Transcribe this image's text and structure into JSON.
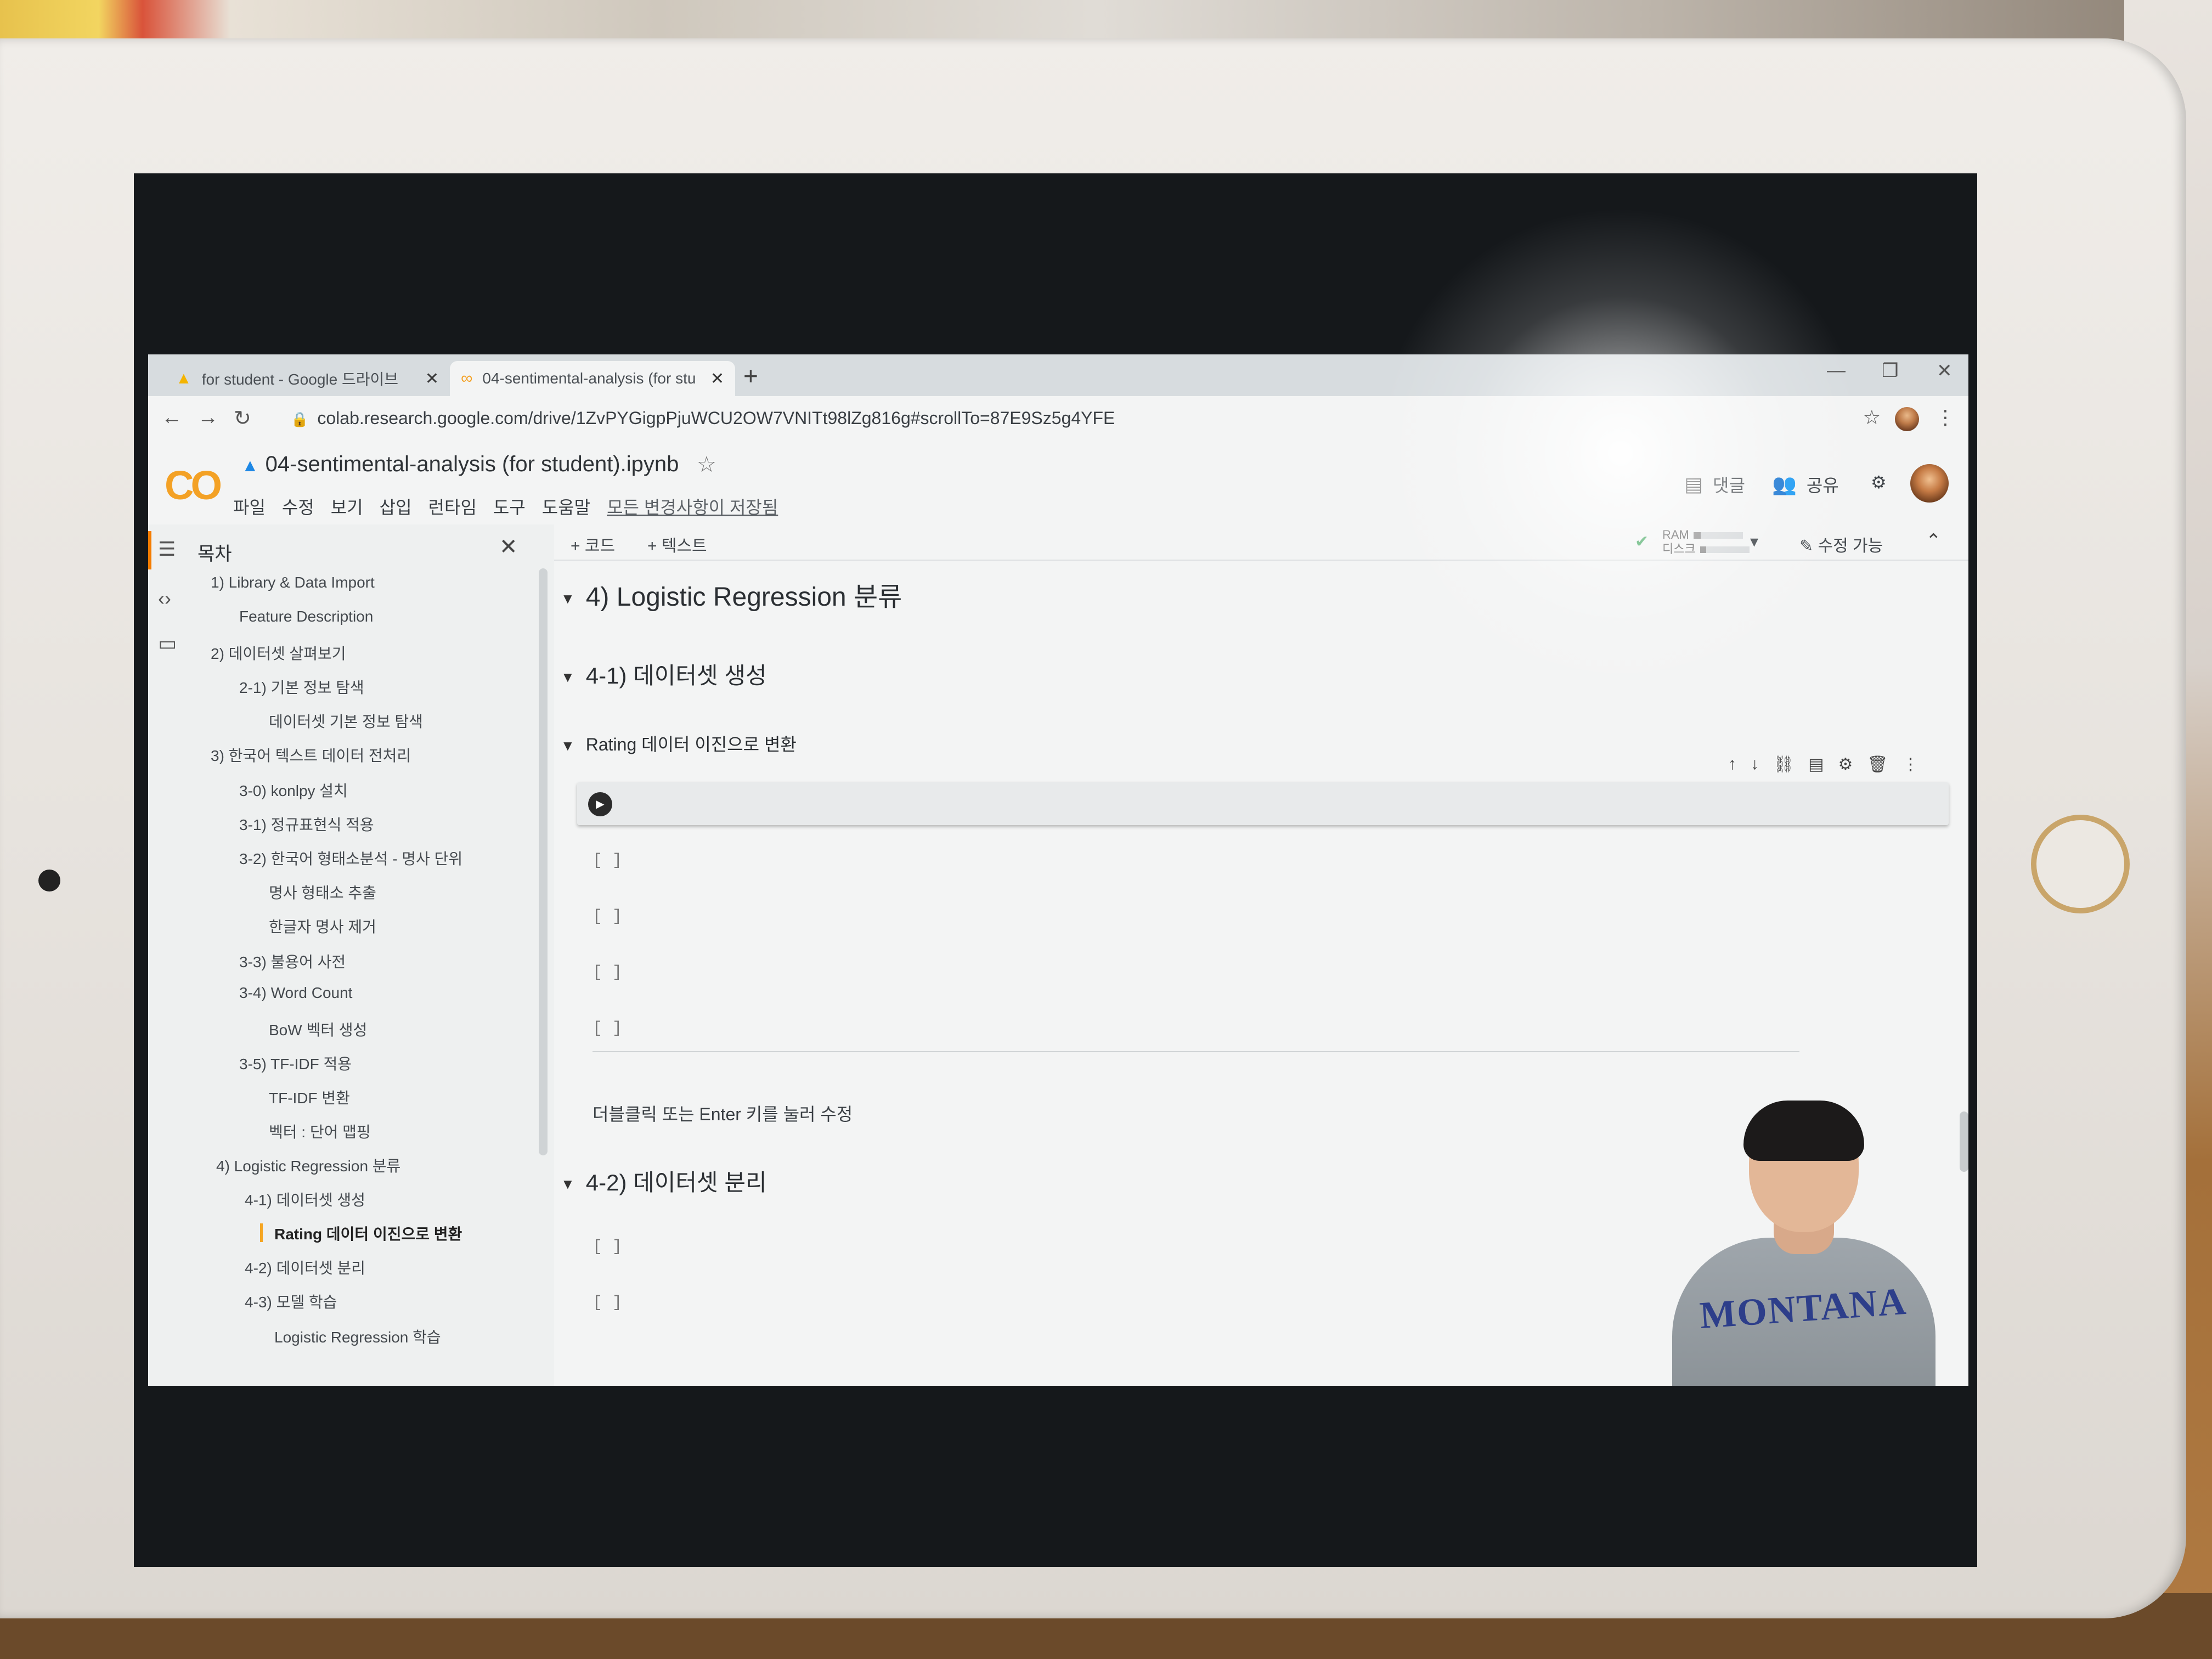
{
  "browser": {
    "tabs": [
      {
        "title": "for student - Google 드라이브",
        "icon": "google-drive-icon"
      },
      {
        "title": "04-sentimental-analysis (for stu",
        "icon": "colab-icon"
      }
    ],
    "new_tab": "+",
    "url": "colab.research.google.com/drive/1ZvPYGigpPjuWCU2OW7VNITt98lZg816g#scrollTo=87E9Sz5g4YFE"
  },
  "colab": {
    "logo": "CO",
    "notebook_title": "04-sentimental-analysis (for student).ipynb",
    "menus": [
      "파일",
      "수정",
      "보기",
      "삽입",
      "런타임",
      "도구",
      "도움말"
    ],
    "save_status": "모든 변경사항이 저장됨",
    "comment_label": "댓글",
    "share_label": "공유",
    "toolbar": {
      "add_code": "+ 코드",
      "add_text": "+ 텍스트",
      "ram_label": "RAM",
      "disk_label": "디스크",
      "ram_usage": 0.15,
      "disk_usage": 0.12,
      "edit_mode": "수정 가능"
    }
  },
  "toc": {
    "title": "목차",
    "items": [
      {
        "label": "1) Library & Data Import",
        "level": 1
      },
      {
        "label": "Feature Description",
        "level": 2
      },
      {
        "label": "2) 데이터셋 살펴보기",
        "level": 1
      },
      {
        "label": "2-1) 기본 정보 탐색",
        "level": 2
      },
      {
        "label": "데이터셋 기본 정보 탐색",
        "level": 3
      },
      {
        "label": "3) 한국어 텍스트 데이터 전처리",
        "level": 1
      },
      {
        "label": "3-0) konlpy 설치",
        "level": 2
      },
      {
        "label": "3-1) 정규표현식 적용",
        "level": 2
      },
      {
        "label": "3-2) 한국어 형태소분석 - 명사 단위",
        "level": 2
      },
      {
        "label": "명사 형태소 추출",
        "level": 3
      },
      {
        "label": "한글자 명사 제거",
        "level": 3
      },
      {
        "label": "3-3) 불용어 사전",
        "level": 2
      },
      {
        "label": "3-4) Word Count",
        "level": 2
      },
      {
        "label": "BoW 벡터 생성",
        "level": 3
      },
      {
        "label": "3-5) TF-IDF 적용",
        "level": 2
      },
      {
        "label": "TF-IDF 변환",
        "level": 3
      },
      {
        "label": "벡터 : 단어 맵핑",
        "level": 3
      },
      {
        "label": "4) Logistic Regression 분류",
        "level": 1
      },
      {
        "label": "4-1) 데이터셋 생성",
        "level": 2
      },
      {
        "label": "Rating 데이터 이진으로 변환",
        "level": 3,
        "active": true
      },
      {
        "label": "4-2) 데이터셋 분리",
        "level": 2
      },
      {
        "label": "4-3) 모델 학습",
        "level": 2
      },
      {
        "label": "Logistic Regression 학습",
        "level": 3
      }
    ]
  },
  "notebook": {
    "h1": "4) Logistic Regression 분류",
    "h2_a": "4-1) 데이터셋 생성",
    "h3": "Rating 데이터 이진으로 변환",
    "empty_cell": "[ ]",
    "edit_hint": "더블클릭 또는 Enter 키를 눌러 수정",
    "h2_b": "4-2) 데이터셋 분리"
  },
  "webcam": {
    "shirt_text": "MONTANA"
  }
}
